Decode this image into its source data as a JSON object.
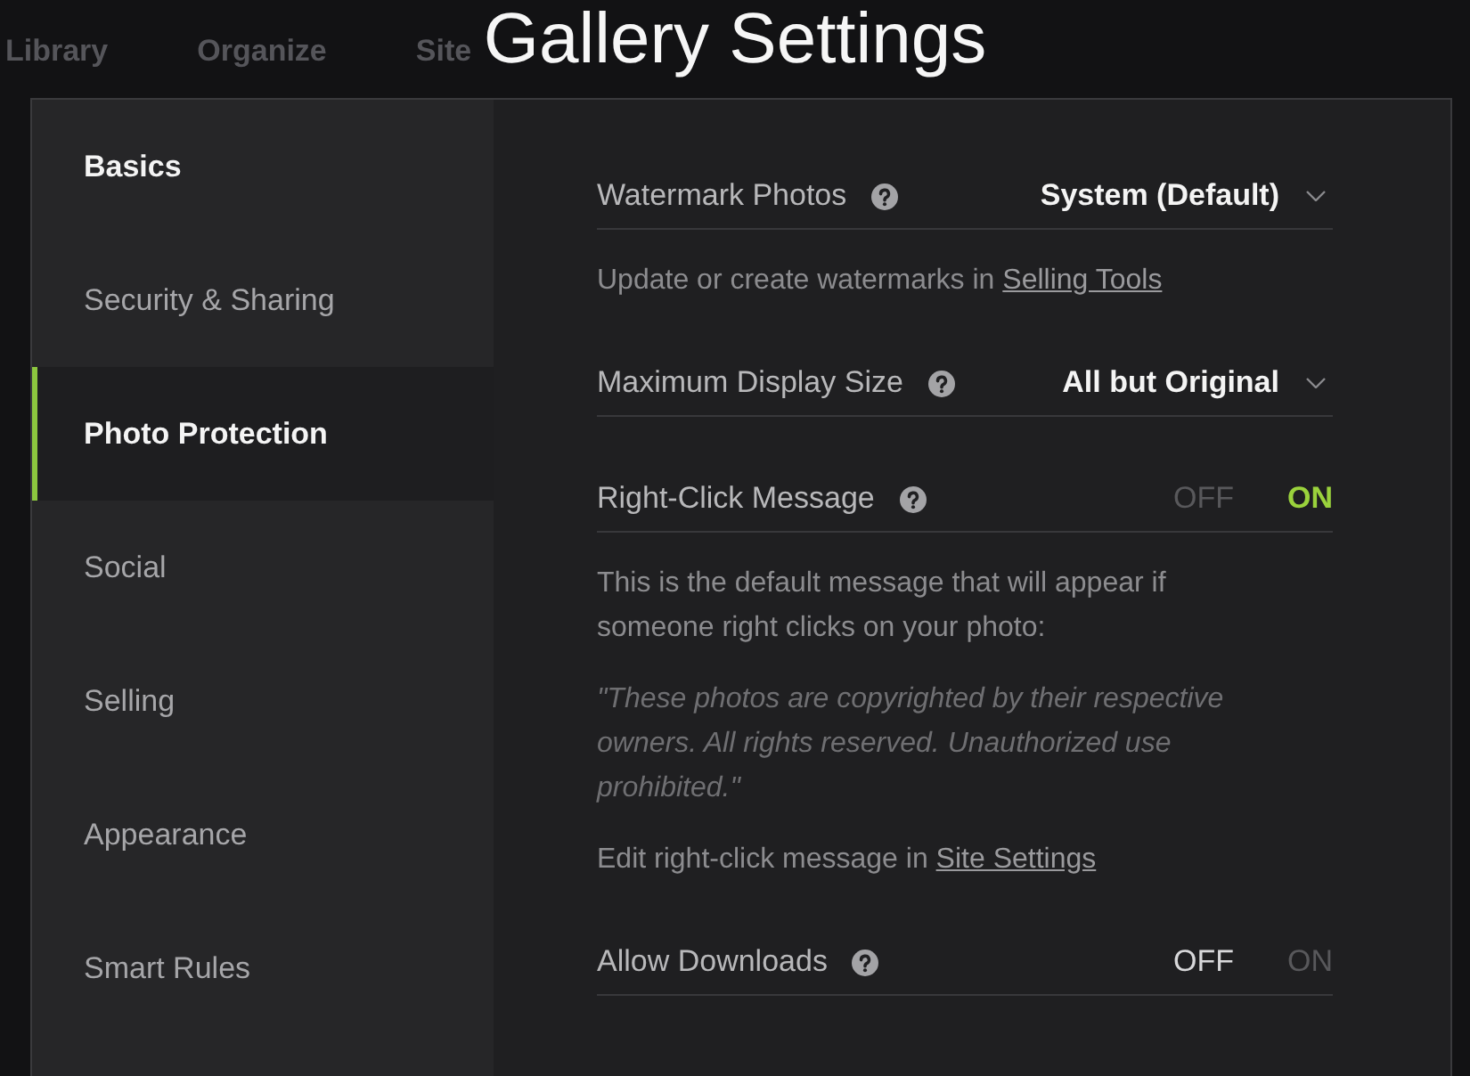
{
  "background_nav": [
    "Library",
    "Organize",
    "Site"
  ],
  "title": "Gallery Settings",
  "sidebar": {
    "items": [
      {
        "label": "Basics",
        "selected": false,
        "hovered": true
      },
      {
        "label": "Security & Sharing",
        "selected": false,
        "hovered": false
      },
      {
        "label": "Photo Protection",
        "selected": true,
        "hovered": false
      },
      {
        "label": "Social",
        "selected": false,
        "hovered": false
      },
      {
        "label": "Selling",
        "selected": false,
        "hovered": false
      },
      {
        "label": "Appearance",
        "selected": false,
        "hovered": false
      },
      {
        "label": "Smart Rules",
        "selected": false,
        "hovered": false
      }
    ]
  },
  "settings": [
    {
      "kind": "select",
      "label": "Watermark Photos",
      "value": "System (Default)"
    },
    {
      "kind": "note",
      "text": "Update or create watermarks in ",
      "link": "Selling Tools"
    },
    {
      "kind": "select",
      "label": "Maximum Display Size",
      "value": "All but Original"
    },
    {
      "kind": "toggle",
      "label": "Right-Click Message",
      "options": [
        {
          "label": "OFF",
          "kind": "off",
          "selected": false
        },
        {
          "label": "ON",
          "kind": "on",
          "selected": true
        }
      ]
    },
    {
      "kind": "paragraph",
      "text": "This is the default message that will appear if someone right clicks on your photo:"
    },
    {
      "kind": "quote",
      "text": "\"These photos are copyrighted by their respective owners. All rights reserved. Unauthorized use prohibited.\""
    },
    {
      "kind": "note",
      "text": "Edit right-click message in ",
      "link": "Site Settings"
    },
    {
      "kind": "toggle",
      "label": "Allow Downloads",
      "options": [
        {
          "label": "OFF",
          "kind": "off",
          "selected": true
        },
        {
          "label": "ON",
          "kind": "on",
          "selected": false
        }
      ]
    }
  ]
}
